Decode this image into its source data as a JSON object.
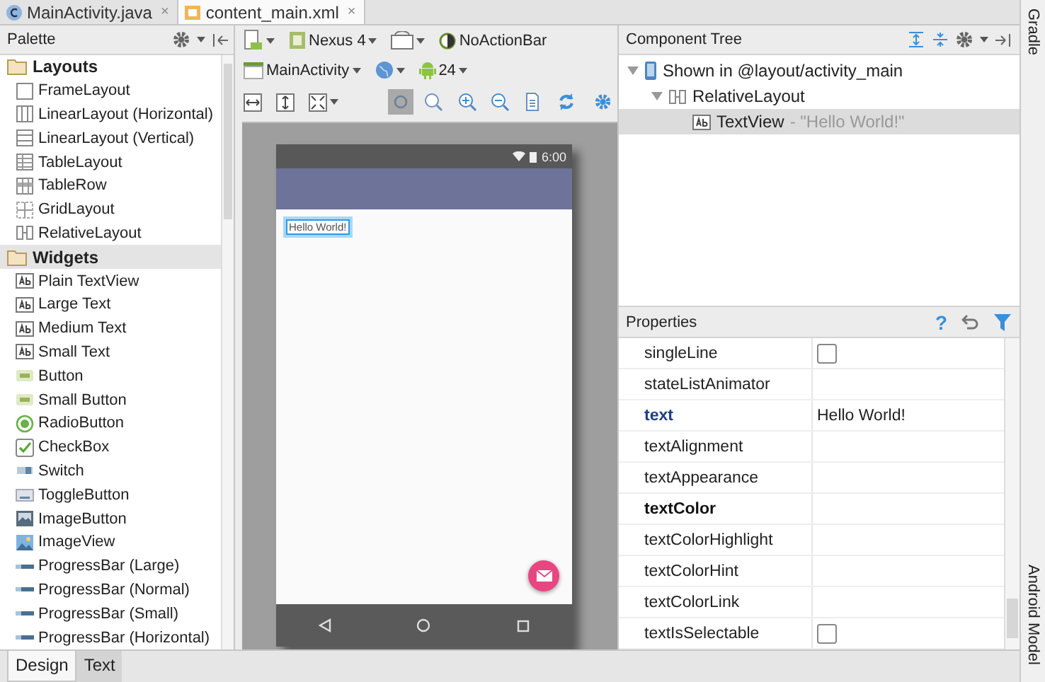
{
  "editor_tabs": [
    {
      "label": "MainActivity.java",
      "kind": "java",
      "selected": false,
      "close": "×"
    },
    {
      "label": "content_main.xml",
      "kind": "xml",
      "selected": true,
      "close": "×"
    }
  ],
  "palette": {
    "title": "Palette",
    "groups": [
      {
        "label": "Layouts",
        "selected": false,
        "items": [
          {
            "label": "FrameLayout",
            "kind": "frame"
          },
          {
            "label": "LinearLayout (Horizontal)",
            "kind": "columns"
          },
          {
            "label": "LinearLayout (Vertical)",
            "kind": "rows"
          },
          {
            "label": "TableLayout",
            "kind": "table"
          },
          {
            "label": "TableRow",
            "kind": "tablerow"
          },
          {
            "label": "GridLayout",
            "kind": "grid"
          },
          {
            "label": "RelativeLayout",
            "kind": "relative"
          }
        ]
      },
      {
        "label": "Widgets",
        "selected": true,
        "items": [
          {
            "label": "Plain TextView",
            "kind": "text"
          },
          {
            "label": "Large Text",
            "kind": "text"
          },
          {
            "label": "Medium Text",
            "kind": "text"
          },
          {
            "label": "Small Text",
            "kind": "text"
          },
          {
            "label": "Button",
            "kind": "button"
          },
          {
            "label": "Small Button",
            "kind": "button"
          },
          {
            "label": "RadioButton",
            "kind": "radio"
          },
          {
            "label": "CheckBox",
            "kind": "checkbox"
          },
          {
            "label": "Switch",
            "kind": "switch"
          },
          {
            "label": "ToggleButton",
            "kind": "toggle"
          },
          {
            "label": "ImageButton",
            "kind": "imagebutton"
          },
          {
            "label": "ImageView",
            "kind": "image"
          },
          {
            "label": "ProgressBar (Large)",
            "kind": "progress"
          },
          {
            "label": "ProgressBar (Normal)",
            "kind": "progress"
          },
          {
            "label": "ProgressBar (Small)",
            "kind": "progress"
          },
          {
            "label": "ProgressBar (Horizontal)",
            "kind": "progress"
          }
        ]
      }
    ]
  },
  "toolbar": {
    "device": "Nexus 4",
    "theme": "NoActionBar",
    "activity": "MainActivity",
    "api": "24",
    "tools": [
      {
        "kind": "pan",
        "selected": true
      },
      {
        "kind": "actual",
        "selected": false
      },
      {
        "kind": "zoom-in",
        "selected": false
      },
      {
        "kind": "zoom-out",
        "selected": false
      },
      {
        "kind": "file",
        "selected": false
      },
      {
        "kind": "refresh",
        "selected": false
      }
    ]
  },
  "preview": {
    "time": "6:00",
    "text": "Hello World!"
  },
  "component_tree": {
    "title": "Component Tree",
    "nodes": [
      {
        "label": "Shown in @layout/activity_main",
        "kind": "device",
        "expanded": true,
        "selected": false,
        "children": [
          {
            "label": "RelativeLayout",
            "kind": "relative",
            "expanded": true,
            "selected": false,
            "children": [
              {
                "label": "TextView",
                "detail": "- \"Hello World!\"",
                "kind": "text",
                "selected": true
              }
            ]
          }
        ]
      }
    ]
  },
  "properties": {
    "title": "Properties",
    "help": "?",
    "rows": [
      {
        "name": "singleLine",
        "kind": "checkbox",
        "checked": false,
        "modified": false,
        "important": false
      },
      {
        "name": "stateListAnimator",
        "kind": "text",
        "modified": false,
        "important": false
      },
      {
        "name": "text",
        "kind": "text",
        "value": "Hello World!",
        "modified": true,
        "important": true
      },
      {
        "name": "textAlignment",
        "kind": "text",
        "modified": false,
        "important": false
      },
      {
        "name": "textAppearance",
        "kind": "text",
        "modified": false,
        "important": false
      },
      {
        "name": "textColor",
        "kind": "text",
        "modified": false,
        "important": true
      },
      {
        "name": "textColorHighlight",
        "kind": "text",
        "modified": false,
        "important": false
      },
      {
        "name": "textColorHint",
        "kind": "text",
        "modified": false,
        "important": false
      },
      {
        "name": "textColorLink",
        "kind": "text",
        "modified": false,
        "important": false
      },
      {
        "name": "textIsSelectable",
        "kind": "checkbox",
        "checked": false,
        "modified": false,
        "important": false
      }
    ]
  },
  "bottom_tabs": [
    {
      "label": "Design",
      "selected": true
    },
    {
      "label": "Text",
      "selected": false
    }
  ],
  "side_tools": [
    "Gradle",
    "Android Model"
  ]
}
